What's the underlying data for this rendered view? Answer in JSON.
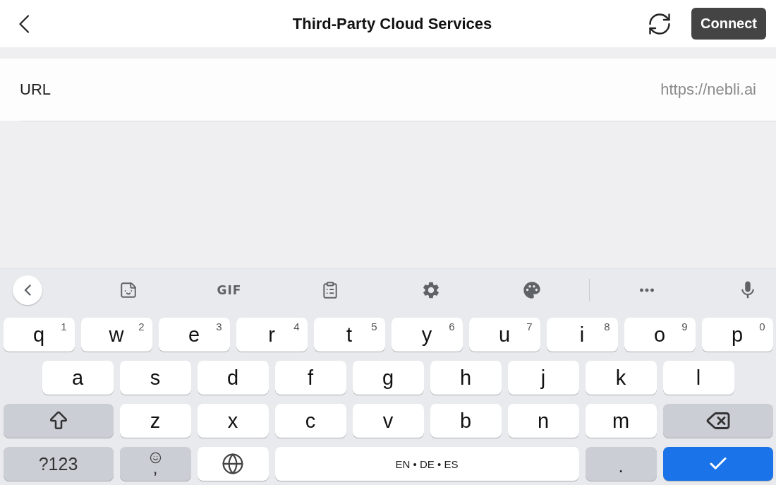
{
  "header": {
    "title": "Third-Party Cloud Services",
    "connect_button": "Connect"
  },
  "url_row": {
    "label": "URL",
    "placeholder": "https://nebli.ai"
  },
  "keyboard": {
    "toolbar": {
      "gif_button": "GIF"
    },
    "rows": [
      {
        "keys": [
          {
            "kind": "letter",
            "label": "q",
            "hint": "1"
          },
          {
            "kind": "letter",
            "label": "w",
            "hint": "2"
          },
          {
            "kind": "letter",
            "label": "e",
            "hint": "3"
          },
          {
            "kind": "letter",
            "label": "r",
            "hint": "4"
          },
          {
            "kind": "letter",
            "label": "t",
            "hint": "5"
          },
          {
            "kind": "letter",
            "label": "y",
            "hint": "6"
          },
          {
            "kind": "letter",
            "label": "u",
            "hint": "7"
          },
          {
            "kind": "letter",
            "label": "i",
            "hint": "8"
          },
          {
            "kind": "letter",
            "label": "o",
            "hint": "9"
          },
          {
            "kind": "letter",
            "label": "p",
            "hint": "0"
          }
        ]
      },
      {
        "keys": [
          {
            "kind": "letter",
            "label": "a"
          },
          {
            "kind": "letter",
            "label": "s"
          },
          {
            "kind": "letter",
            "label": "d"
          },
          {
            "kind": "letter",
            "label": "f"
          },
          {
            "kind": "letter",
            "label": "g"
          },
          {
            "kind": "letter",
            "label": "h"
          },
          {
            "kind": "letter",
            "label": "j"
          },
          {
            "kind": "letter",
            "label": "k"
          },
          {
            "kind": "letter",
            "label": "l"
          }
        ]
      },
      {
        "keys": [
          {
            "kind": "shift"
          },
          {
            "kind": "letter",
            "label": "z"
          },
          {
            "kind": "letter",
            "label": "x"
          },
          {
            "kind": "letter",
            "label": "c"
          },
          {
            "kind": "letter",
            "label": "v"
          },
          {
            "kind": "letter",
            "label": "b"
          },
          {
            "kind": "letter",
            "label": "n"
          },
          {
            "kind": "letter",
            "label": "m"
          },
          {
            "kind": "backspace"
          }
        ]
      },
      {
        "keys": [
          {
            "kind": "symbols",
            "label": "?123"
          },
          {
            "kind": "emoji_comma",
            "label": ","
          },
          {
            "kind": "globe"
          },
          {
            "kind": "space",
            "label": "EN • DE • ES"
          },
          {
            "kind": "period",
            "label": "."
          },
          {
            "kind": "enter"
          }
        ]
      }
    ]
  }
}
